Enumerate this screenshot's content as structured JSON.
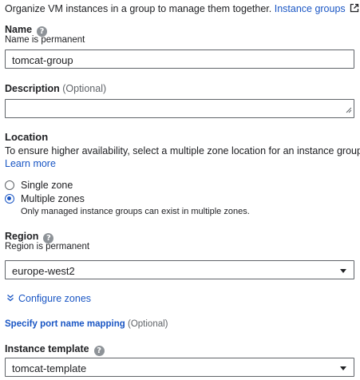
{
  "intro": {
    "text": "Organize VM instances in a group to manage them together.",
    "link": "Instance groups",
    "link_icon": "external-link-icon"
  },
  "name": {
    "label": "Name",
    "help_icon": "help-icon",
    "sub": "Name is permanent",
    "value": "tomcat-group"
  },
  "description": {
    "label": "Description",
    "optional": "(Optional)",
    "value": ""
  },
  "location": {
    "label": "Location",
    "text": "To ensure higher availability, select a multiple zone location for an instance group.",
    "learn_more": "Learn more",
    "options": [
      {
        "label": "Single zone",
        "selected": false
      },
      {
        "label": "Multiple zones",
        "selected": true,
        "hint": "Only managed instance groups can exist in multiple zones."
      }
    ]
  },
  "region": {
    "label": "Region",
    "help_icon": "help-icon",
    "sub": "Region is permanent",
    "value": "europe-west2"
  },
  "configure_zones": {
    "label": "Configure zones",
    "icon": "chevron-double-down-icon"
  },
  "port_mapping": {
    "label": "Specify port name mapping",
    "optional": "(Optional)"
  },
  "instance_template": {
    "label": "Instance template",
    "help_icon": "help-icon",
    "value": "tomcat-template"
  },
  "colors": {
    "link": "#1a56c4",
    "text": "#202124",
    "muted": "#5f6368"
  }
}
